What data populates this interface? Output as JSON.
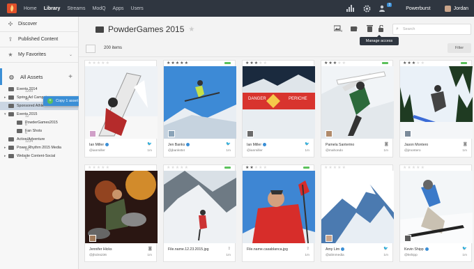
{
  "nav": {
    "items": [
      "Home",
      "Library",
      "Streams",
      "ModQ",
      "Apps",
      "Users"
    ],
    "active": "Library",
    "org": "Powerburst",
    "user": "Jordan",
    "notif_count": "3"
  },
  "sidebar": {
    "links": [
      {
        "label": "Discover",
        "icon": "compass-icon"
      },
      {
        "label": "Published Content",
        "icon": "upload-icon"
      },
      {
        "label": "My Favorites",
        "icon": "star-icon"
      }
    ],
    "all_assets": "All Assets",
    "tree": [
      {
        "label": "Events 2014",
        "count": "1200",
        "arrow": "",
        "indent": 0
      },
      {
        "label": "Spring Ad Campaign",
        "count": "45",
        "arrow": "▸",
        "indent": 0
      },
      {
        "label": "Sponsored Athle",
        "count": "",
        "arrow": "",
        "indent": 0,
        "selected": true
      },
      {
        "label": "Events 2015",
        "count": "12",
        "arrow": "▾",
        "indent": 0
      },
      {
        "label": "PowderGames2015",
        "count": "8",
        "arrow": "",
        "indent": 1
      },
      {
        "label": "Fan Shots",
        "count": "6",
        "arrow": "",
        "indent": 1
      },
      {
        "label": "Action/Adventure",
        "count": "1234",
        "arrow": "",
        "indent": 0
      },
      {
        "label": "Power Rhythm 2015 Media",
        "count": "80",
        "arrow": "▸",
        "indent": 0
      },
      {
        "label": "Website Content-Social",
        "count": "6",
        "arrow": "▸",
        "indent": 0
      }
    ],
    "copy_label": "Copy 1 asset"
  },
  "main": {
    "title": "PowderGames 2015",
    "search_placeholder": "Search",
    "tooltip": "Manage access",
    "count_label": "200 items",
    "filter_label": "Filter"
  },
  "cards": [
    {
      "stars": 0,
      "green": false,
      "name": "Ian Miller",
      "verified": true,
      "handle": "@ianmiller",
      "src": "twitter-icon",
      "time": "1m",
      "avatar": true
    },
    {
      "stars": 5,
      "green": true,
      "name": "Jen Banks",
      "verified": true,
      "handle": "@jbanks54",
      "src": "twitter-icon",
      "time": "1m",
      "avatar": true
    },
    {
      "stars": 3,
      "green": false,
      "name": "Ian Miller",
      "verified": true,
      "handle": "@ianmiller",
      "src": "twitter-icon",
      "time": "1m",
      "avatar": true
    },
    {
      "stars": 3,
      "green": true,
      "name": "Pamela Santerino",
      "verified": false,
      "handle": "@mahondo",
      "src": "instagram-icon",
      "time": "1m",
      "avatar": true
    },
    {
      "stars": 3,
      "green": true,
      "name": "Jason Montero",
      "verified": false,
      "handle": "@jmontero",
      "src": "instagram-icon",
      "time": "1m",
      "avatar": true
    },
    {
      "stars": 0,
      "green": false,
      "name": "Jennifer Hicks",
      "verified": false,
      "handle": "@jhicks236",
      "src": "instagram-icon",
      "time": "1m",
      "avatar": true
    },
    {
      "stars": 0,
      "green": true,
      "name": "File.name.12.23.2015.jpg",
      "verified": false,
      "handle": "",
      "src": "upload-icon",
      "time": "1m",
      "avatar": false
    },
    {
      "stars": 2,
      "green": true,
      "name": "File.name.casablanca.jpg",
      "verified": false,
      "handle": "",
      "src": "upload-icon",
      "time": "1m",
      "avatar": false
    },
    {
      "stars": 0,
      "green": false,
      "name": "Amy Lim",
      "verified": true,
      "handle": "@alimmedia",
      "src": "twitter-icon",
      "time": "1m",
      "avatar": true
    },
    {
      "stars": 0,
      "green": false,
      "name": "Kevin Shipp",
      "verified": true,
      "handle": "@kshipp",
      "src": "twitter-icon",
      "time": "1m",
      "avatar": true
    }
  ]
}
